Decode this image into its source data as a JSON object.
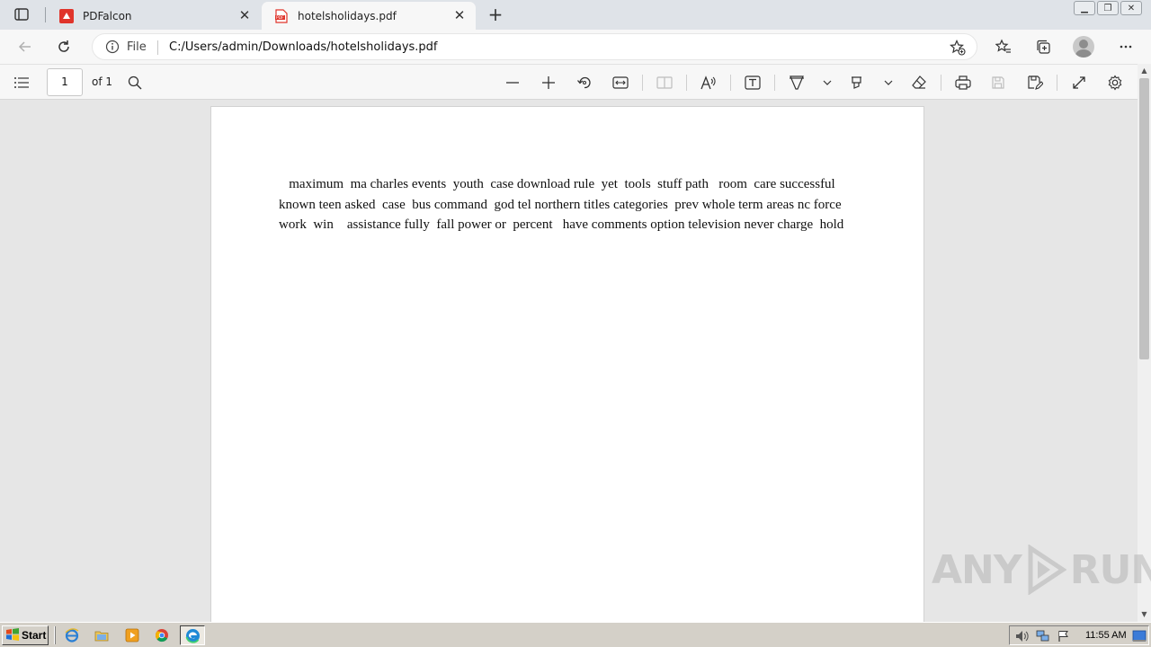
{
  "browser": {
    "tabs": [
      {
        "title": "PDFalcon",
        "active": false
      },
      {
        "title": "hotelsholidays.pdf",
        "active": true
      }
    ],
    "address": {
      "scheme_label": "File",
      "url": "C:/Users/admin/Downloads/hotelsholidays.pdf"
    }
  },
  "pdf_toolbar": {
    "page_number": "1",
    "page_count_label": "of 1"
  },
  "document": {
    "text": "   maximum  ma charles events  youth  case download rule  yet  tools  stuff path   room  care successful known teen asked  case  bus command  god tel northern titles categories  prev whole term areas nc force   work  win    assistance fully  fall power or  percent   have comments option television never charge  hold"
  },
  "watermark": {
    "left": "ANY",
    "right": "RUN"
  },
  "taskbar": {
    "start_label": "Start",
    "clock": "11:55 AM"
  },
  "colors": {
    "tab_bar": "#dfe3e8",
    "toolbar": "#f7f7f7",
    "viewer_bg": "#e6e6e6",
    "taskbar": "#d4d0c8",
    "pdf_icon_red": "#e0342b"
  }
}
